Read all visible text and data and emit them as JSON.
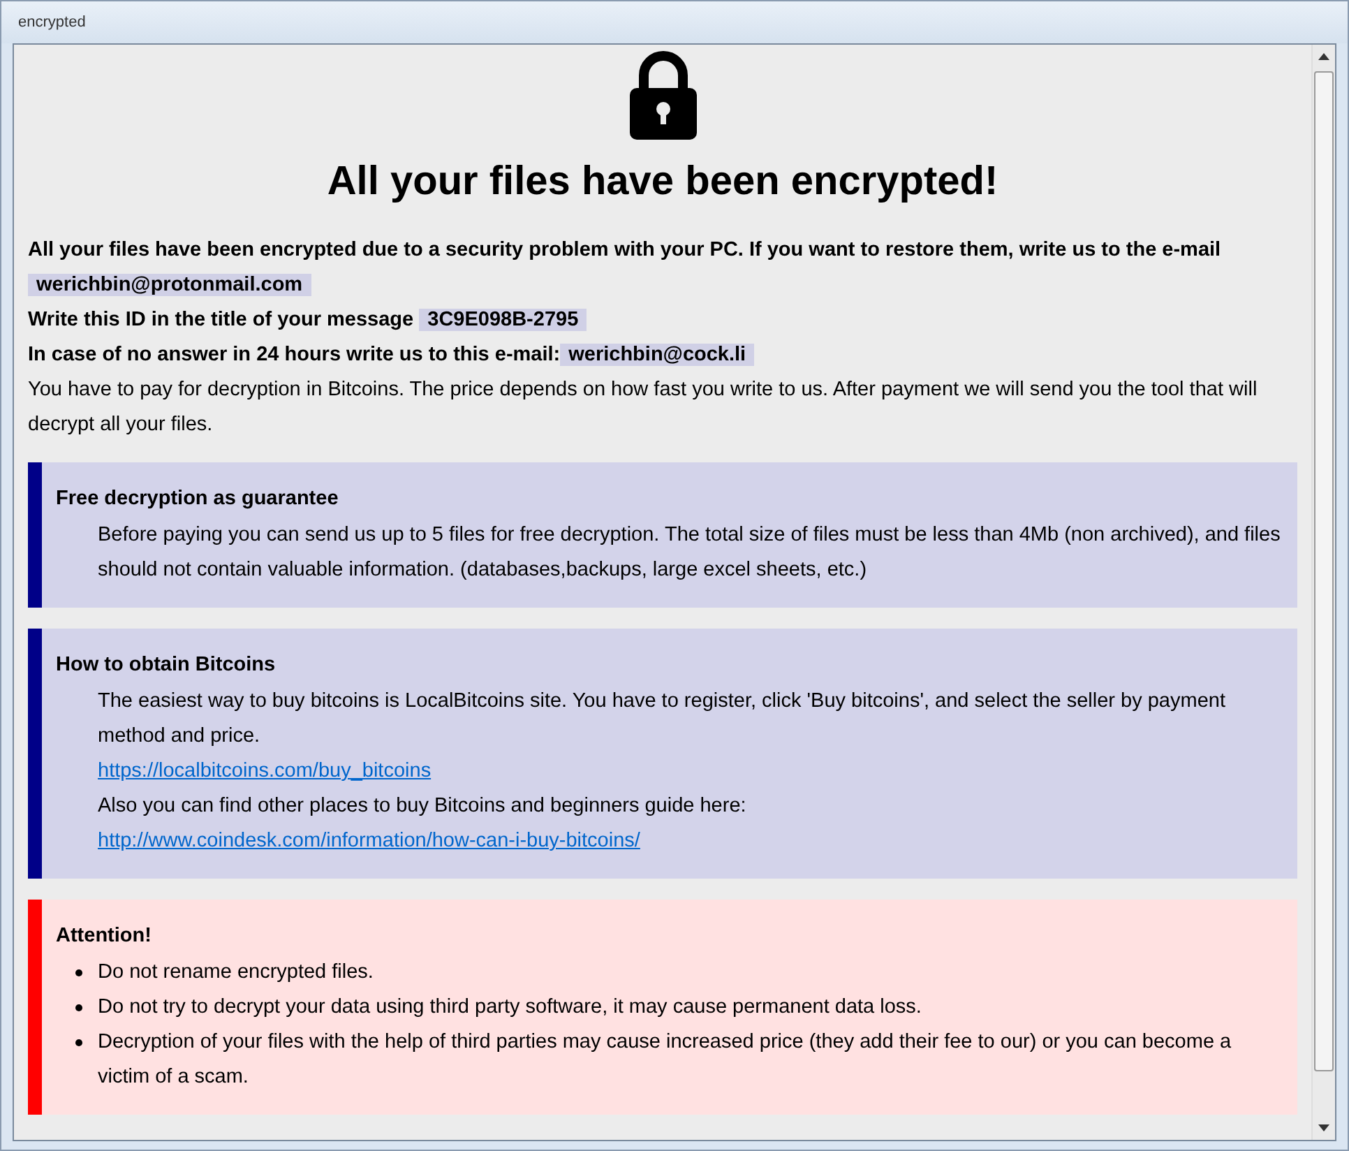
{
  "window": {
    "title": "encrypted"
  },
  "heading": "All your files have been encrypted!",
  "intro": {
    "restore_text": "All your files have been encrypted due to a security problem with your PC. If you want to restore them, write us to the e-mail",
    "email": "werichbin@protonmail.com",
    "id_text": "Write this ID in the title of your message",
    "id": "3C9E098B-2795",
    "backup_text": "In case of no answer in 24 hours write us to this e-mail:",
    "backup_email": "werichbin@cock.li",
    "payment": "You have to pay for decryption in Bitcoins. The price depends on how fast you write to us. After payment we will send you the tool that will decrypt all your files."
  },
  "sections": [
    {
      "kind": "info",
      "color": "#000088",
      "title": "Free decryption as guarantee",
      "items": [
        {
          "kind": "text",
          "text": "Before paying you can send us up to 5 files for free decryption. The total size of files must be less than 4Mb (non archived), and files should not contain valuable information. (databases,backups, large excel sheets, etc.)"
        }
      ]
    },
    {
      "kind": "info",
      "color": "#000088",
      "title": "How to obtain Bitcoins",
      "items": [
        {
          "kind": "text",
          "text": "The easiest way to buy bitcoins is LocalBitcoins site. You have to register, click 'Buy bitcoins', and select the seller by payment method and price."
        },
        {
          "kind": "link",
          "text": "https://localbitcoins.com/buy_bitcoins"
        },
        {
          "kind": "text",
          "text": "Also you can find other places to buy Bitcoins and beginners guide here:"
        },
        {
          "kind": "link",
          "text": "http://www.coindesk.com/information/how-can-i-buy-bitcoins/"
        }
      ]
    },
    {
      "kind": "warning",
      "color": "#ff0000",
      "title": "Attention!",
      "items": [
        {
          "kind": "bullet",
          "text": "Do not rename encrypted files."
        },
        {
          "kind": "bullet",
          "text": "Do not try to decrypt your data using third party software, it may cause permanent data loss."
        },
        {
          "kind": "bullet",
          "text": "Decryption of your files with the help of third parties may cause increased price (they add their fee to our) or you can become a victim of a scam."
        }
      ]
    }
  ]
}
